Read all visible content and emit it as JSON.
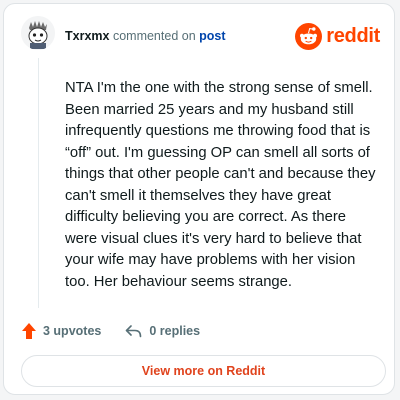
{
  "header": {
    "username": "Txrxmx",
    "action_text": " commented on ",
    "post_link": "post"
  },
  "brand": {
    "name": "reddit",
    "icon": "reddit-logo-icon",
    "color": "#ff4500"
  },
  "comment": {
    "body": "NTA I'm the one with the strong sense of smell. Been married 25 years and my husband still infrequently questions me throwing food that is “off” out. I'm guessing OP can smell all sorts of things that other people can't and because they can't smell it themselves they have great difficulty believing you are correct. As there were visual clues it's very hard to believe that your wife may have problems with her vision too. Her behaviour seems strange."
  },
  "actions": {
    "upvotes": "3 upvotes",
    "replies": "0 replies",
    "upvote_icon": "upvote-arrow-icon",
    "reply_icon": "reply-arrow-icon"
  },
  "cta": {
    "label": "View more on Reddit"
  },
  "colors": {
    "accent": "#ff4500",
    "link": "#0045ac",
    "muted": "#576f76"
  }
}
